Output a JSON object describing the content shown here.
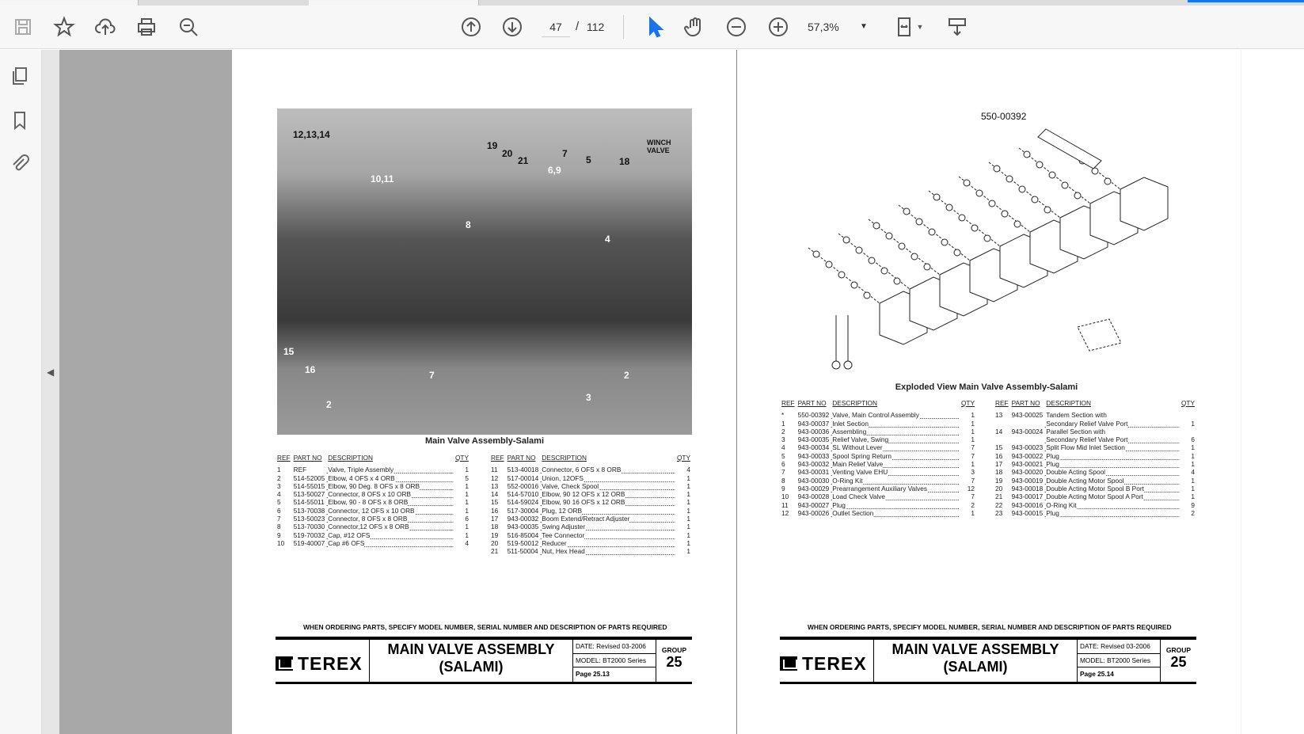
{
  "toolbar": {
    "page_current": "47",
    "page_sep": "/",
    "page_total": "112",
    "zoom": "57,3%"
  },
  "left_page": {
    "photo_callouts": [
      "12,13,14",
      "10,11",
      "19",
      "20",
      "21",
      "7",
      "6,9",
      "5",
      "18",
      "WINCH",
      "VALVE",
      "8",
      "4",
      "15",
      "16",
      "2",
      "7",
      "3",
      "2"
    ],
    "caption": "Main Valve Assembly-Salami",
    "headers": [
      "REF",
      "PART NO",
      "DESCRIPTION",
      "QTY"
    ],
    "rows_left": [
      [
        "1",
        "REF",
        "Valve, Triple Assembly",
        "1"
      ],
      [
        "2",
        "514-52005",
        "Elbow, 4 OFS x 4 ORB",
        "5"
      ],
      [
        "3",
        "514-55015",
        "Elbow, 90 Deg. 8 OFS x 8 ORB",
        "1"
      ],
      [
        "4",
        "513-50027",
        "Connector, 8 OFS x 10 ORB",
        "1"
      ],
      [
        "5",
        "514-55011",
        "Elbow, 90 - 8 OFS x 8 ORB",
        "1"
      ],
      [
        "6",
        "513-70038",
        "Connector, 12 OFS x 10 ORB",
        "1"
      ],
      [
        "7",
        "513-50023",
        "Connector, 8 OFS x 8 ORB",
        "6"
      ],
      [
        "8",
        "513-70030",
        "Connector,12 OFS x 8 ORB",
        "1"
      ],
      [
        "9",
        "519-70032",
        "Cap, #12 OFS",
        "1"
      ],
      [
        "10",
        "519-40007",
        "Cap #6 OFS",
        "4"
      ]
    ],
    "rows_right": [
      [
        "11",
        "513-40018",
        "Connector, 6 OFS x 8 ORB",
        "4"
      ],
      [
        "12",
        "517-00014",
        "Union, 12OFS",
        "1"
      ],
      [
        "13",
        "552-00016",
        "Valve, Check Spool",
        "1"
      ],
      [
        "14",
        "514-57010",
        "Elbow, 90 12 OFS x 12 ORB",
        "1"
      ],
      [
        "15",
        "514-59024",
        "Elbow, 90 16 OFS x 12 ORB",
        "1"
      ],
      [
        "16",
        "517-30004",
        "Plug, 12 ORB",
        "1"
      ],
      [
        "17",
        "943-00032",
        "Boom Extend/Retract Adjuster",
        "1"
      ],
      [
        "18",
        "943-00035",
        "Swing Adjuster",
        "1"
      ],
      [
        "19",
        "516-85004",
        "Tee Connector",
        "1"
      ],
      [
        "20",
        "519-50012",
        "Reducer",
        "1"
      ],
      [
        "21",
        "511-50004",
        "Nut, Hex Head",
        "1"
      ]
    ],
    "notice": "WHEN ORDERING PARTS, SPECIFY MODEL NUMBER, SERIAL NUMBER AND DESCRIPTION OF PARTS REQUIRED",
    "logo": "TEREX",
    "title1": "MAIN VALVE ASSEMBLY",
    "title2": "(SALAMI)",
    "date": "DATE:   Revised 03-2006",
    "model": "MODEL:  BT2000 Series",
    "page": "Page  25.13",
    "group_label": "GROUP",
    "group": "25"
  },
  "right_page": {
    "diagram_label": "550-00392",
    "caption": "Exploded View   Main Valve Assembly-Salami",
    "headers": [
      "REF",
      "PART NO",
      "DESCRIPTION",
      "QTY"
    ],
    "rows_left": [
      [
        "*",
        "550-00392",
        "Valve, Main Control Assembly",
        "1"
      ],
      [
        "1",
        "943-00037",
        "Inlet Section",
        "1"
      ],
      [
        "2",
        "943-00036",
        "Assembling",
        "1"
      ],
      [
        "3",
        "943-00035",
        "Relief Valve, Swing",
        "1"
      ],
      [
        "4",
        "943-00034",
        "SL Without Lever",
        "7"
      ],
      [
        "5",
        "943-00033",
        "Spool Spring Return",
        "7"
      ],
      [
        "6",
        "943-00032",
        "Main Relief Valve",
        "1"
      ],
      [
        "7",
        "943-00031",
        "Venting Valve EHU",
        "3"
      ],
      [
        "8",
        "943-00030",
        "O-Ring Kit",
        "7"
      ],
      [
        "9",
        "943-00029",
        "Prearrangement Auxiliary Valves",
        "12"
      ],
      [
        "10",
        "943-00028",
        "Load Check Valve",
        "7"
      ],
      [
        "11",
        "943-00027",
        "Plug",
        "2"
      ],
      [
        "12",
        "943-00026",
        "Outlet Section",
        "1"
      ]
    ],
    "rows_right": [
      [
        "13",
        "943-00025",
        "Tandem Section with",
        ""
      ],
      [
        "",
        "",
        "Secondary Relief Valve Port",
        "1"
      ],
      [
        "14",
        "943-00024",
        "Parallel Section with",
        ""
      ],
      [
        "",
        "",
        "Secondary Relief Valve Port",
        "6"
      ],
      [
        "15",
        "943-00023",
        "Split Flow Mid Inlet Section",
        "1"
      ],
      [
        "16",
        "943-00022",
        "Plug",
        "1"
      ],
      [
        "17",
        "943-00021",
        "Plug",
        "1"
      ],
      [
        "18",
        "943-00020",
        "Double Acting Spool",
        "4"
      ],
      [
        "19",
        "943-00019",
        "Double Acting Motor Spool",
        "1"
      ],
      [
        "20",
        "943-00018",
        "Double Acting Motor Spool B Port",
        "1"
      ],
      [
        "21",
        "943-00017",
        "Double Acting Motor Spool A Port",
        "1"
      ],
      [
        "22",
        "943-00016",
        "O-Ring Kit",
        "9"
      ],
      [
        "23",
        "943-00015",
        "Plug",
        "2"
      ]
    ],
    "notice": "WHEN ORDERING PARTS, SPECIFY MODEL NUMBER, SERIAL NUMBER AND DESCRIPTION OF PARTS REQUIRED",
    "logo": "TEREX",
    "title1": "MAIN VALVE ASSEMBLY",
    "title2": "(SALAMI)",
    "date": "DATE:   Revised 03-2006",
    "model": "MODEL:  BT2000 Series",
    "page": "Page  25.14",
    "group_label": "GROUP",
    "group": "25"
  }
}
